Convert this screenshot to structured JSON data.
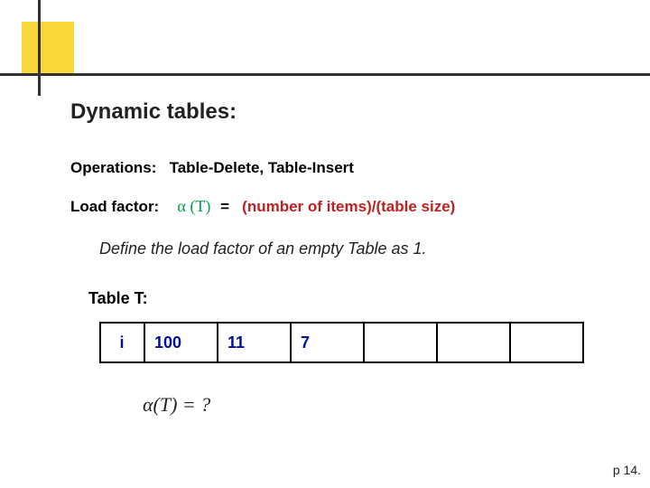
{
  "title": "Dynamic tables:",
  "operations": {
    "label": "Operations:",
    "value": "Table-Delete, Table-Insert"
  },
  "load_factor": {
    "label": "Load factor:",
    "symbol": "α (T)",
    "equals": "=",
    "desc": "(number of items)/(table size)"
  },
  "definition": "Define the load factor of an empty Table as 1.",
  "table": {
    "label": "Table T:",
    "header": "i",
    "cells": [
      "100",
      "11",
      "7",
      "",
      "",
      ""
    ]
  },
  "alpha_question": "α(T) = ?",
  "page_number": "p 14."
}
